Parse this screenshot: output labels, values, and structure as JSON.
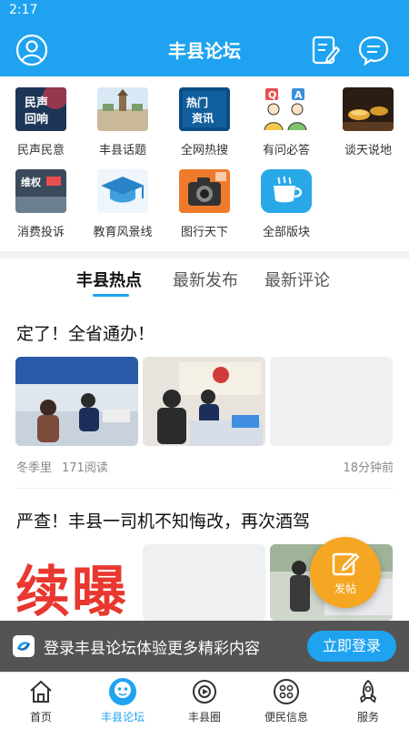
{
  "status_bar": {
    "time": "2:17"
  },
  "header": {
    "title": "丰县论坛",
    "accent": "#1fa3f0"
  },
  "grid": [
    {
      "label": "民声民意",
      "thumb_text": "民声\n回响",
      "icon": "voice-thumb"
    },
    {
      "label": "丰县话题",
      "icon": "town-thumb"
    },
    {
      "label": "全网热搜",
      "thumb_text": "热门资讯",
      "icon": "hot-news-thumb"
    },
    {
      "label": "有问必答",
      "icon": "qa-thumb"
    },
    {
      "label": "谈天说地",
      "icon": "tea-thumb"
    },
    {
      "label": "消费投诉",
      "thumb_text": "维权",
      "icon": "complaint-thumb"
    },
    {
      "label": "教育风景线",
      "icon": "graduation-cap-icon"
    },
    {
      "label": "图行天下",
      "icon": "camera-thumb"
    },
    {
      "label": "全部版块",
      "icon": "coffee-cup-icon"
    }
  ],
  "tabs": [
    {
      "label": "丰县热点",
      "active": true
    },
    {
      "label": "最新发布",
      "active": false
    },
    {
      "label": "最新评论",
      "active": false
    }
  ],
  "posts": [
    {
      "title": "定了！全省通办！",
      "author": "冬季里",
      "reads": "171阅读",
      "time": "18分钟前"
    },
    {
      "title": "严查！丰县一司机不知悔改，再次酒驾",
      "image_text": "续曝"
    }
  ],
  "fab": {
    "label": "发帖",
    "color": "#f5a623"
  },
  "login_bar": {
    "text": "登录丰县论坛体验更多精彩内容",
    "button": "立即登录"
  },
  "tabbar": [
    {
      "label": "首页",
      "icon": "home-icon"
    },
    {
      "label": "丰县论坛",
      "icon": "forum-mascot-icon",
      "active": true
    },
    {
      "label": "丰县圈",
      "icon": "circle-icon"
    },
    {
      "label": "便民信息",
      "icon": "services-grid-icon"
    },
    {
      "label": "服务",
      "icon": "rocket-icon"
    }
  ]
}
